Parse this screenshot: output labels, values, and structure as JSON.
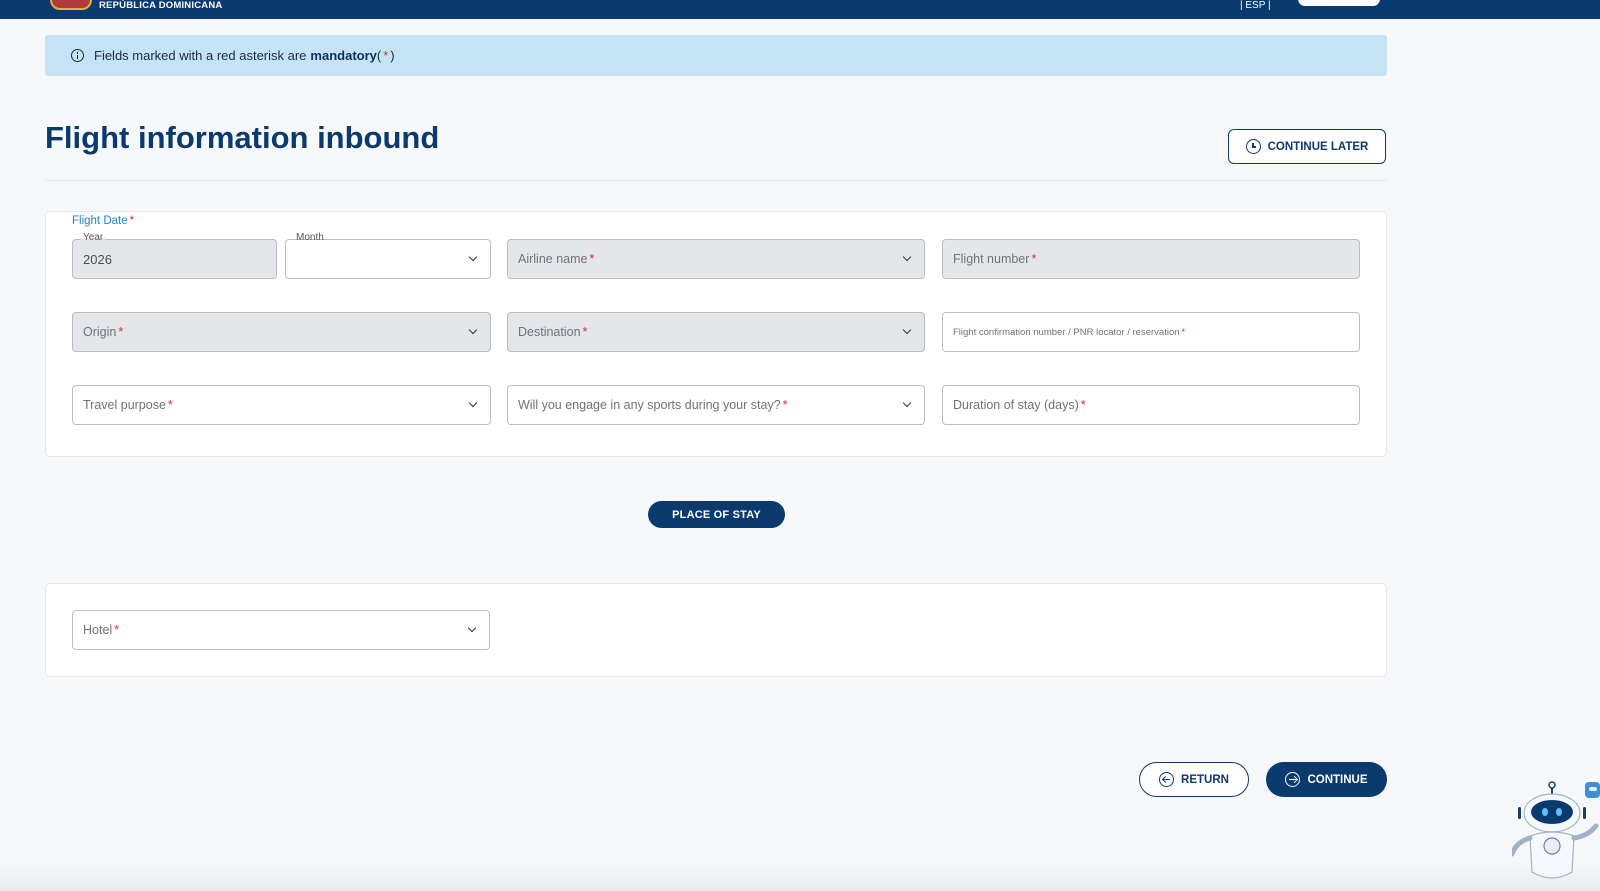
{
  "header": {
    "brand": "REPÚBLICA DOMINICANA",
    "lang_fragment": "| ESP |"
  },
  "notice": {
    "text": "Fields marked with a red asterisk are",
    "bold": "mandatory",
    "paren_open": "(",
    "asterisk": "*",
    "paren_close": ")"
  },
  "page": {
    "title": "Flight information inbound",
    "continue_later": "CONTINUE LATER"
  },
  "form": {
    "flight_date_label": "Flight Date",
    "required_mark": "*",
    "year": {
      "label": "Year",
      "value": "2026"
    },
    "month": {
      "label": "Month",
      "value": ""
    },
    "airline": {
      "placeholder": "Airline name"
    },
    "flight_number": {
      "placeholder": "Flight number"
    },
    "origin": {
      "placeholder": "Origin"
    },
    "destination": {
      "placeholder": "Destination"
    },
    "confirmation": {
      "placeholder": "Flight confirmation number / PNR locator / reservation"
    },
    "travel_purpose": {
      "placeholder": "Travel purpose"
    },
    "sports": {
      "placeholder": "Will you engage in any sports during your stay?"
    },
    "duration": {
      "placeholder": "Duration of stay (days)"
    }
  },
  "place_of_stay": {
    "section_label": "PLACE OF STAY",
    "hotel": {
      "placeholder": "Hotel"
    }
  },
  "actions": {
    "return": "RETURN",
    "continue": "CONTINUE"
  },
  "colors": {
    "primary": "#0b3a6e",
    "notice_bg": "#c4e4f6",
    "required": "#e12b2b",
    "label_blue": "#1c88c7"
  }
}
